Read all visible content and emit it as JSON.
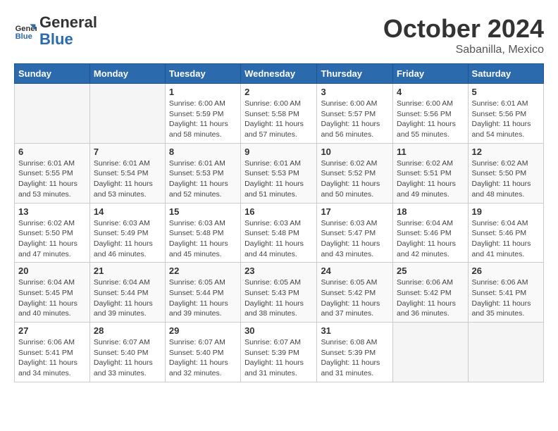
{
  "header": {
    "logo_general": "General",
    "logo_blue": "Blue",
    "month": "October 2024",
    "location": "Sabanilla, Mexico"
  },
  "days_of_week": [
    "Sunday",
    "Monday",
    "Tuesday",
    "Wednesday",
    "Thursday",
    "Friday",
    "Saturday"
  ],
  "weeks": [
    [
      {
        "day": "",
        "info": ""
      },
      {
        "day": "",
        "info": ""
      },
      {
        "day": "1",
        "info": "Sunrise: 6:00 AM\nSunset: 5:59 PM\nDaylight: 11 hours and 58 minutes."
      },
      {
        "day": "2",
        "info": "Sunrise: 6:00 AM\nSunset: 5:58 PM\nDaylight: 11 hours and 57 minutes."
      },
      {
        "day": "3",
        "info": "Sunrise: 6:00 AM\nSunset: 5:57 PM\nDaylight: 11 hours and 56 minutes."
      },
      {
        "day": "4",
        "info": "Sunrise: 6:00 AM\nSunset: 5:56 PM\nDaylight: 11 hours and 55 minutes."
      },
      {
        "day": "5",
        "info": "Sunrise: 6:01 AM\nSunset: 5:56 PM\nDaylight: 11 hours and 54 minutes."
      }
    ],
    [
      {
        "day": "6",
        "info": "Sunrise: 6:01 AM\nSunset: 5:55 PM\nDaylight: 11 hours and 53 minutes."
      },
      {
        "day": "7",
        "info": "Sunrise: 6:01 AM\nSunset: 5:54 PM\nDaylight: 11 hours and 53 minutes."
      },
      {
        "day": "8",
        "info": "Sunrise: 6:01 AM\nSunset: 5:53 PM\nDaylight: 11 hours and 52 minutes."
      },
      {
        "day": "9",
        "info": "Sunrise: 6:01 AM\nSunset: 5:53 PM\nDaylight: 11 hours and 51 minutes."
      },
      {
        "day": "10",
        "info": "Sunrise: 6:02 AM\nSunset: 5:52 PM\nDaylight: 11 hours and 50 minutes."
      },
      {
        "day": "11",
        "info": "Sunrise: 6:02 AM\nSunset: 5:51 PM\nDaylight: 11 hours and 49 minutes."
      },
      {
        "day": "12",
        "info": "Sunrise: 6:02 AM\nSunset: 5:50 PM\nDaylight: 11 hours and 48 minutes."
      }
    ],
    [
      {
        "day": "13",
        "info": "Sunrise: 6:02 AM\nSunset: 5:50 PM\nDaylight: 11 hours and 47 minutes."
      },
      {
        "day": "14",
        "info": "Sunrise: 6:03 AM\nSunset: 5:49 PM\nDaylight: 11 hours and 46 minutes."
      },
      {
        "day": "15",
        "info": "Sunrise: 6:03 AM\nSunset: 5:48 PM\nDaylight: 11 hours and 45 minutes."
      },
      {
        "day": "16",
        "info": "Sunrise: 6:03 AM\nSunset: 5:48 PM\nDaylight: 11 hours and 44 minutes."
      },
      {
        "day": "17",
        "info": "Sunrise: 6:03 AM\nSunset: 5:47 PM\nDaylight: 11 hours and 43 minutes."
      },
      {
        "day": "18",
        "info": "Sunrise: 6:04 AM\nSunset: 5:46 PM\nDaylight: 11 hours and 42 minutes."
      },
      {
        "day": "19",
        "info": "Sunrise: 6:04 AM\nSunset: 5:46 PM\nDaylight: 11 hours and 41 minutes."
      }
    ],
    [
      {
        "day": "20",
        "info": "Sunrise: 6:04 AM\nSunset: 5:45 PM\nDaylight: 11 hours and 40 minutes."
      },
      {
        "day": "21",
        "info": "Sunrise: 6:04 AM\nSunset: 5:44 PM\nDaylight: 11 hours and 39 minutes."
      },
      {
        "day": "22",
        "info": "Sunrise: 6:05 AM\nSunset: 5:44 PM\nDaylight: 11 hours and 39 minutes."
      },
      {
        "day": "23",
        "info": "Sunrise: 6:05 AM\nSunset: 5:43 PM\nDaylight: 11 hours and 38 minutes."
      },
      {
        "day": "24",
        "info": "Sunrise: 6:05 AM\nSunset: 5:42 PM\nDaylight: 11 hours and 37 minutes."
      },
      {
        "day": "25",
        "info": "Sunrise: 6:06 AM\nSunset: 5:42 PM\nDaylight: 11 hours and 36 minutes."
      },
      {
        "day": "26",
        "info": "Sunrise: 6:06 AM\nSunset: 5:41 PM\nDaylight: 11 hours and 35 minutes."
      }
    ],
    [
      {
        "day": "27",
        "info": "Sunrise: 6:06 AM\nSunset: 5:41 PM\nDaylight: 11 hours and 34 minutes."
      },
      {
        "day": "28",
        "info": "Sunrise: 6:07 AM\nSunset: 5:40 PM\nDaylight: 11 hours and 33 minutes."
      },
      {
        "day": "29",
        "info": "Sunrise: 6:07 AM\nSunset: 5:40 PM\nDaylight: 11 hours and 32 minutes."
      },
      {
        "day": "30",
        "info": "Sunrise: 6:07 AM\nSunset: 5:39 PM\nDaylight: 11 hours and 31 minutes."
      },
      {
        "day": "31",
        "info": "Sunrise: 6:08 AM\nSunset: 5:39 PM\nDaylight: 11 hours and 31 minutes."
      },
      {
        "day": "",
        "info": ""
      },
      {
        "day": "",
        "info": ""
      }
    ]
  ]
}
